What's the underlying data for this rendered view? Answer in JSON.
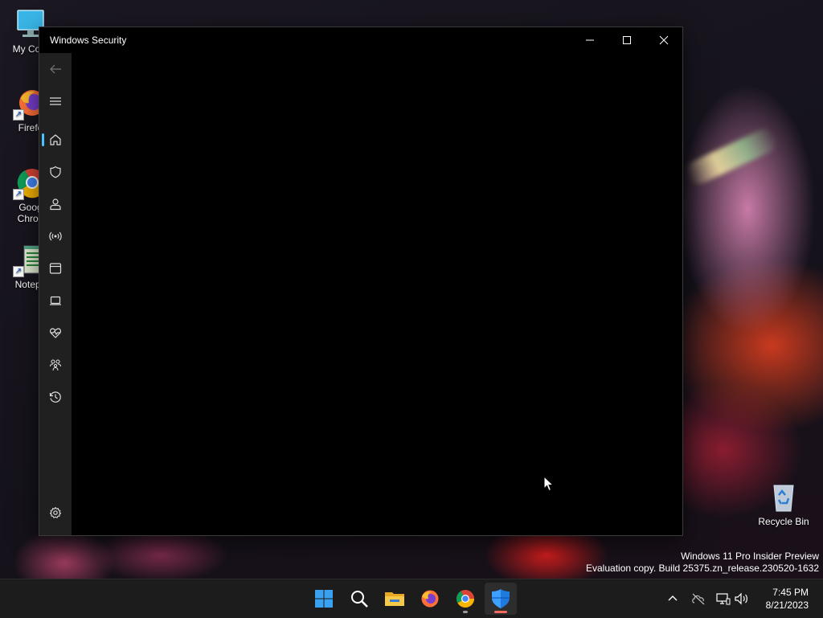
{
  "desktop": {
    "icons": [
      {
        "label": "My Com",
        "icon": "computer-icon"
      },
      {
        "label": "Firefo",
        "icon": "firefox-icon"
      },
      {
        "label": "Goog\nChron",
        "icon": "chrome-icon"
      },
      {
        "label": "Notepa",
        "icon": "notepad-icon"
      },
      {
        "label": "Recycle Bin",
        "icon": "recycle-bin-icon"
      }
    ],
    "watermark": {
      "line1": "Windows 11 Pro Insider Preview",
      "line2": "Evaluation copy. Build 25375.zn_release.230520-1632"
    }
  },
  "window": {
    "title": "Windows Security",
    "controls": {
      "minimize": "minimize-icon",
      "maximize": "maximize-icon",
      "close": "close-icon"
    },
    "nav": [
      {
        "name": "back",
        "icon": "back-arrow-icon"
      },
      {
        "name": "menu",
        "icon": "hamburger-menu-icon"
      },
      {
        "name": "home",
        "icon": "home-icon",
        "active": true
      },
      {
        "name": "virus-protection",
        "icon": "shield-icon"
      },
      {
        "name": "account-protection",
        "icon": "person-icon"
      },
      {
        "name": "firewall-network",
        "icon": "wireless-icon"
      },
      {
        "name": "app-browser-control",
        "icon": "browser-window-icon"
      },
      {
        "name": "device-security",
        "icon": "laptop-icon"
      },
      {
        "name": "device-performance",
        "icon": "heart-pulse-icon"
      },
      {
        "name": "family-options",
        "icon": "family-icon"
      },
      {
        "name": "protection-history",
        "icon": "history-icon"
      },
      {
        "name": "settings",
        "icon": "gear-icon"
      }
    ]
  },
  "taskbar": {
    "apps": [
      {
        "name": "start",
        "icon": "windows-logo-icon"
      },
      {
        "name": "search",
        "icon": "search-icon"
      },
      {
        "name": "file-explorer",
        "icon": "folder-icon"
      },
      {
        "name": "firefox",
        "icon": "firefox-icon"
      },
      {
        "name": "chrome",
        "icon": "chrome-icon"
      },
      {
        "name": "windows-security",
        "icon": "security-shield-icon",
        "active": true
      }
    ],
    "tray": [
      "chevron-up-icon",
      "network-off-icon",
      "display-network-icon",
      "volume-icon"
    ],
    "time": "7:45 PM",
    "date": "8/21/2023"
  },
  "colors": {
    "accent": "#4cc2ff",
    "sidebar": "#202020",
    "taskbar": "#1c1c1c",
    "active_indicator": "#f36b5c"
  }
}
